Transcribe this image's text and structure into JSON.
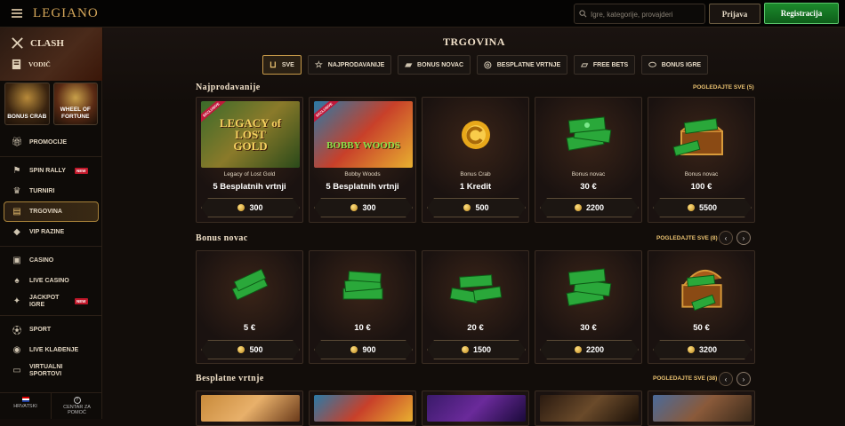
{
  "header": {
    "logo": "LEGIANO",
    "search_placeholder": "Igre, kategorije, provajderi",
    "login": "Prijava",
    "register": "Registracija"
  },
  "sidebar": {
    "clash": "CLASH",
    "vodic": "VODIČ",
    "tiles": [
      "BONUS CRAB",
      "WHEEL OF FORTUNE"
    ],
    "items": [
      {
        "label": "PROMOCIJE",
        "icon": "gift-icon"
      },
      {
        "label": "SPIN RALLY",
        "icon": "flag-icon",
        "badge": "NEW"
      },
      {
        "label": "TURNIRI",
        "icon": "trophy-icon"
      },
      {
        "label": "TRGOVINA",
        "icon": "shop-icon"
      },
      {
        "label": "VIP RAZINE",
        "icon": "diamond-icon"
      },
      {
        "label": "CASINO",
        "icon": "slot-icon"
      },
      {
        "label": "LIVE CASINO",
        "icon": "cards-icon"
      },
      {
        "label": "JACKPOT IGRE",
        "icon": "jackpot-icon",
        "badge": "NEW"
      },
      {
        "label": "SPORT",
        "icon": "ball-icon"
      },
      {
        "label": "LIVE KLAĐENJE",
        "icon": "live-bet-icon"
      },
      {
        "label": "VIRTUALNI SPORTOVI",
        "icon": "virtual-icon"
      }
    ],
    "language": "HRVATSKI",
    "help": "CENTAR ZA POMOĆ"
  },
  "page": {
    "title": "TRGOVINA"
  },
  "filters": [
    {
      "label": "SVE",
      "icon": "basket-icon",
      "active": true
    },
    {
      "label": "NAJPRODAVANIJE",
      "icon": "star-icon"
    },
    {
      "label": "BONUS NOVAC",
      "icon": "cash-icon"
    },
    {
      "label": "BESPLATNE VRTNJE",
      "icon": "spin-icon"
    },
    {
      "label": "FREE BETS",
      "icon": "ticket-icon"
    },
    {
      "label": "BONUS IGRE",
      "icon": "gamepad-icon"
    }
  ],
  "sections": [
    {
      "title": "Najprodavanije",
      "link": "POGLEDAJTE SVE (5)",
      "cards": [
        {
          "name": "Legacy of Lost Gold",
          "value": "5 Besplatnih vrtnji",
          "price": "300",
          "kind": "game1",
          "badge": "EXCLUSIVE",
          "game_title": "LEGACY of LOST GOLD"
        },
        {
          "name": "Bobby Woods",
          "value": "5 Besplatnih vrtnji",
          "price": "300",
          "kind": "game2",
          "badge": "EXCLUSIVE",
          "game_title": "BOBBY WOODS"
        },
        {
          "name": "Bonus Crab",
          "value": "1 Kredit",
          "price": "500",
          "kind": "crab"
        },
        {
          "name": "Bonus novac",
          "value": "30 €",
          "price": "2200",
          "kind": "cash"
        },
        {
          "name": "Bonus novac",
          "value": "100 €",
          "price": "5500",
          "kind": "chest"
        }
      ]
    },
    {
      "title": "Bonus novac",
      "link": "POGLEDAJTE SVE (8)",
      "cards": [
        {
          "value": "5 €",
          "price": "500",
          "kind": "cash"
        },
        {
          "value": "10 €",
          "price": "900",
          "kind": "cash"
        },
        {
          "value": "20 €",
          "price": "1500",
          "kind": "cash"
        },
        {
          "value": "30 €",
          "price": "2200",
          "kind": "cash"
        },
        {
          "value": "50 €",
          "price": "3200",
          "kind": "chest"
        }
      ]
    },
    {
      "title": "Besplatne vrtnje",
      "link": "POGLEDAJTE SVE (38)"
    }
  ]
}
